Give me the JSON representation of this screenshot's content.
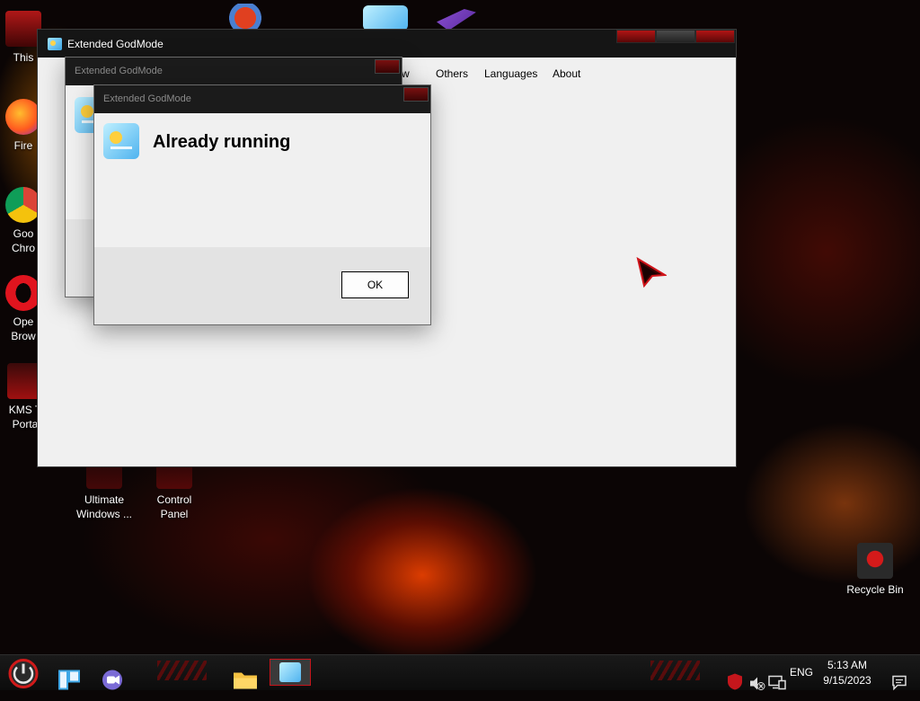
{
  "desktop": {
    "icons": [
      {
        "name": "this-pc",
        "label": "This"
      },
      {
        "name": "firefox",
        "label": "Fire"
      },
      {
        "name": "google-chrome",
        "label": "Goo\nChro"
      },
      {
        "name": "opera-browser",
        "label": "Ope\nBrow"
      },
      {
        "name": "kms-portable",
        "label": "KMS T\nPorta"
      },
      {
        "name": "ultimate-windows",
        "label": "Ultimate\nWindows ..."
      },
      {
        "name": "control-panel",
        "label": "Control\nPanel"
      },
      {
        "name": "recycle-bin",
        "label": "Recycle Bin"
      }
    ],
    "accent_color": "#c4161c"
  },
  "main_window": {
    "title": "Extended GodMode",
    "menu": {
      "partial": "w",
      "others": "Others",
      "languages": "Languages",
      "about": "About"
    }
  },
  "dialog_back": {
    "title": "Extended GodMode"
  },
  "dialog_front": {
    "title": "Extended GodMode",
    "message": "Already running",
    "ok_label": "OK"
  },
  "taskbar": {
    "items": [
      "start-icon",
      "task-view-icon",
      "chat-icon",
      "file-explorer-icon",
      "extended-godmode-icon"
    ],
    "tray": {
      "language": "ENG",
      "time": "5:13 AM",
      "date": "9/15/2023"
    }
  }
}
